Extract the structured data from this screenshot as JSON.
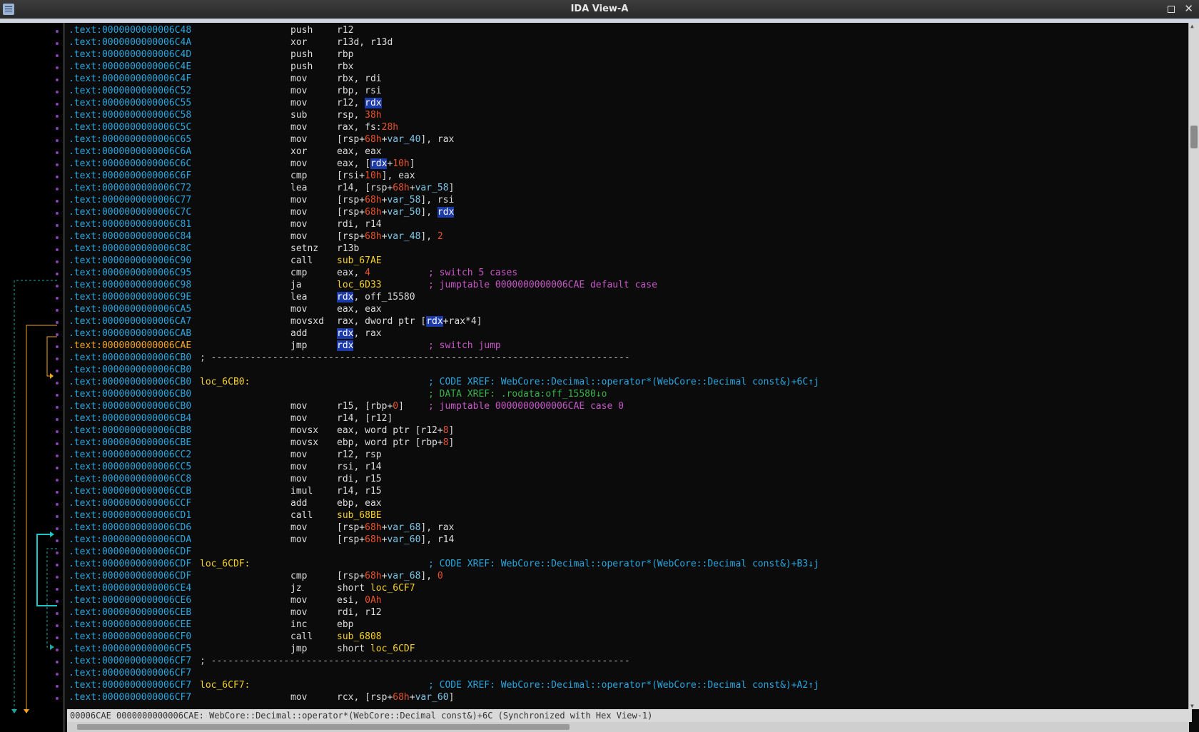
{
  "window": {
    "title": "IDA View-A"
  },
  "status": "00006CAE 0000000000006CAE: WebCore::Decimal::operator*(WebCore::Decimal const&)+6C (Synchronized with Hex View-1)",
  "rows": [
    {
      "a": ".text:0000000000006C48",
      "m": "push",
      "o": [
        [
          "r12",
          "reg"
        ]
      ]
    },
    {
      "a": ".text:0000000000006C4A",
      "m": "xor",
      "o": [
        [
          "r13d, r13d",
          "reg"
        ]
      ]
    },
    {
      "a": ".text:0000000000006C4D",
      "m": "push",
      "o": [
        [
          "rbp",
          "reg"
        ]
      ]
    },
    {
      "a": ".text:0000000000006C4E",
      "m": "push",
      "o": [
        [
          "rbx",
          "reg"
        ]
      ]
    },
    {
      "a": ".text:0000000000006C4F",
      "m": "mov",
      "o": [
        [
          "rbx, rdi",
          "reg"
        ]
      ]
    },
    {
      "a": ".text:0000000000006C52",
      "m": "mov",
      "o": [
        [
          "rbp, rsi",
          "reg"
        ]
      ]
    },
    {
      "a": ".text:0000000000006C55",
      "m": "mov",
      "o": [
        [
          "r12, ",
          "reg"
        ],
        [
          "rdx",
          "hl"
        ]
      ]
    },
    {
      "a": ".text:0000000000006C58",
      "m": "sub",
      "o": [
        [
          "rsp, ",
          "reg"
        ],
        [
          "38h",
          "num"
        ]
      ]
    },
    {
      "a": ".text:0000000000006C5C",
      "m": "mov",
      "o": [
        [
          "rax, fs:",
          "reg"
        ],
        [
          "28h",
          "num"
        ]
      ]
    },
    {
      "a": ".text:0000000000006C65",
      "m": "mov",
      "o": [
        [
          "[rsp+",
          "reg"
        ],
        [
          "68h",
          "num"
        ],
        [
          "+",
          "reg"
        ],
        [
          "var_40",
          "var"
        ],
        [
          "], rax",
          "reg"
        ]
      ]
    },
    {
      "a": ".text:0000000000006C6A",
      "m": "xor",
      "o": [
        [
          "eax, eax",
          "reg"
        ]
      ]
    },
    {
      "a": ".text:0000000000006C6C",
      "m": "mov",
      "o": [
        [
          "eax, [",
          "reg"
        ],
        [
          "rdx",
          "hl"
        ],
        [
          "+",
          "reg"
        ],
        [
          "10h",
          "num"
        ],
        [
          "]",
          "reg"
        ]
      ]
    },
    {
      "a": ".text:0000000000006C6F",
      "m": "cmp",
      "o": [
        [
          "[rsi+",
          "reg"
        ],
        [
          "10h",
          "num"
        ],
        [
          "], eax",
          "reg"
        ]
      ]
    },
    {
      "a": ".text:0000000000006C72",
      "m": "lea",
      "o": [
        [
          "r14, [rsp+",
          "reg"
        ],
        [
          "68h",
          "num"
        ],
        [
          "+",
          "reg"
        ],
        [
          "var_58",
          "var"
        ],
        [
          "]",
          "reg"
        ]
      ]
    },
    {
      "a": ".text:0000000000006C77",
      "m": "mov",
      "o": [
        [
          "[rsp+",
          "reg"
        ],
        [
          "68h",
          "num"
        ],
        [
          "+",
          "reg"
        ],
        [
          "var_58",
          "var"
        ],
        [
          "], rsi",
          "reg"
        ]
      ]
    },
    {
      "a": ".text:0000000000006C7C",
      "m": "mov",
      "o": [
        [
          "[rsp+",
          "reg"
        ],
        [
          "68h",
          "num"
        ],
        [
          "+",
          "reg"
        ],
        [
          "var_50",
          "var"
        ],
        [
          "], ",
          "reg"
        ],
        [
          "rdx",
          "hl"
        ]
      ]
    },
    {
      "a": ".text:0000000000006C81",
      "m": "mov",
      "o": [
        [
          "rdi, r14",
          "reg"
        ]
      ]
    },
    {
      "a": ".text:0000000000006C84",
      "m": "mov",
      "o": [
        [
          "[rsp+",
          "reg"
        ],
        [
          "68h",
          "num"
        ],
        [
          "+",
          "reg"
        ],
        [
          "var_48",
          "var"
        ],
        [
          "], ",
          "reg"
        ],
        [
          "2",
          "num"
        ]
      ]
    },
    {
      "a": ".text:0000000000006C8C",
      "m": "setnz",
      "o": [
        [
          "r13b",
          "reg"
        ]
      ]
    },
    {
      "a": ".text:0000000000006C90",
      "m": "call",
      "o": [
        [
          "sub_67AE",
          "sym"
        ]
      ]
    },
    {
      "a": ".text:0000000000006C95",
      "m": "cmp",
      "o": [
        [
          "eax, ",
          "reg"
        ],
        [
          "4",
          "num"
        ]
      ],
      "c": [
        [
          "; switch 5 cases",
          "mag"
        ]
      ]
    },
    {
      "a": ".text:0000000000006C98",
      "m": "ja",
      "o": [
        [
          "loc_6D33",
          "sym"
        ]
      ],
      "c": [
        [
          "; jumptable 0000000000006CAE default case",
          "mag"
        ]
      ]
    },
    {
      "a": ".text:0000000000006C9E",
      "m": "lea",
      "o": [
        [
          "rdx",
          "hl"
        ],
        [
          ", off_15580",
          "reg"
        ]
      ]
    },
    {
      "a": ".text:0000000000006CA5",
      "m": "mov",
      "o": [
        [
          "eax, eax",
          "reg"
        ]
      ]
    },
    {
      "a": ".text:0000000000006CA7",
      "m": "movsxd",
      "o": [
        [
          "rax, dword ptr [",
          "reg"
        ],
        [
          "rdx",
          "hl"
        ],
        [
          "+rax*4]",
          "reg"
        ]
      ]
    },
    {
      "a": ".text:0000000000006CAB",
      "m": "add",
      "o": [
        [
          "rdx",
          "hl"
        ],
        [
          ", rax",
          "reg"
        ]
      ]
    },
    {
      "a": ".text:0000000000006CAE",
      "cur": true,
      "m": "jmp",
      "o": [
        [
          "rdx",
          "hl"
        ]
      ],
      "c": [
        [
          "; switch jump",
          "mag"
        ]
      ]
    },
    {
      "a": ".text:0000000000006CB0",
      "sep": "; ---------------------------------------------------------------------------"
    },
    {
      "a": ".text:0000000000006CB0"
    },
    {
      "a": ".text:0000000000006CB0",
      "l": "loc_6CB0:",
      "c": [
        [
          "; CODE XREF: WebCore::Decimal::operator*(WebCore::Decimal const&)+6C↑j",
          "cyan"
        ]
      ]
    },
    {
      "a": ".text:0000000000006CB0",
      "c": [
        [
          "; DATA XREF: .rodata:off_15580↓o",
          "green"
        ]
      ]
    },
    {
      "a": ".text:0000000000006CB0",
      "m": "mov",
      "o": [
        [
          "r15, [rbp+",
          "reg"
        ],
        [
          "0",
          "num"
        ],
        [
          "]",
          "reg"
        ]
      ],
      "c": [
        [
          "; jumptable 0000000000006CAE case 0",
          "mag"
        ]
      ]
    },
    {
      "a": ".text:0000000000006CB4",
      "m": "mov",
      "o": [
        [
          "r14, [r12]",
          "reg"
        ]
      ]
    },
    {
      "a": ".text:0000000000006CB8",
      "m": "movsx",
      "o": [
        [
          "eax, word ptr [r12+",
          "reg"
        ],
        [
          "8",
          "num"
        ],
        [
          "]",
          "reg"
        ]
      ]
    },
    {
      "a": ".text:0000000000006CBE",
      "m": "movsx",
      "o": [
        [
          "ebp, word ptr [rbp+",
          "reg"
        ],
        [
          "8",
          "num"
        ],
        [
          "]",
          "reg"
        ]
      ]
    },
    {
      "a": ".text:0000000000006CC2",
      "m": "mov",
      "o": [
        [
          "r12, rsp",
          "reg"
        ]
      ]
    },
    {
      "a": ".text:0000000000006CC5",
      "m": "mov",
      "o": [
        [
          "rsi, r14",
          "reg"
        ]
      ]
    },
    {
      "a": ".text:0000000000006CC8",
      "m": "mov",
      "o": [
        [
          "rdi, r15",
          "reg"
        ]
      ]
    },
    {
      "a": ".text:0000000000006CCB",
      "m": "imul",
      "o": [
        [
          "r14, r15",
          "reg"
        ]
      ]
    },
    {
      "a": ".text:0000000000006CCF",
      "m": "add",
      "o": [
        [
          "ebp, eax",
          "reg"
        ]
      ]
    },
    {
      "a": ".text:0000000000006CD1",
      "m": "call",
      "o": [
        [
          "sub_68BE",
          "sym"
        ]
      ]
    },
    {
      "a": ".text:0000000000006CD6",
      "m": "mov",
      "o": [
        [
          "[rsp+",
          "reg"
        ],
        [
          "68h",
          "num"
        ],
        [
          "+",
          "reg"
        ],
        [
          "var_68",
          "var"
        ],
        [
          "], rax",
          "reg"
        ]
      ]
    },
    {
      "a": ".text:0000000000006CDA",
      "m": "mov",
      "o": [
        [
          "[rsp+",
          "reg"
        ],
        [
          "68h",
          "num"
        ],
        [
          "+",
          "reg"
        ],
        [
          "var_60",
          "var"
        ],
        [
          "], r14",
          "reg"
        ]
      ]
    },
    {
      "a": ".text:0000000000006CDF"
    },
    {
      "a": ".text:0000000000006CDF",
      "l": "loc_6CDF:",
      "c": [
        [
          "; CODE XREF: WebCore::Decimal::operator*(WebCore::Decimal const&)+B3↓j",
          "cyan"
        ]
      ]
    },
    {
      "a": ".text:0000000000006CDF",
      "m": "cmp",
      "o": [
        [
          "[rsp+",
          "reg"
        ],
        [
          "68h",
          "num"
        ],
        [
          "+",
          "reg"
        ],
        [
          "var_68",
          "var"
        ],
        [
          "], ",
          "reg"
        ],
        [
          "0",
          "num"
        ]
      ]
    },
    {
      "a": ".text:0000000000006CE4",
      "m": "jz",
      "o": [
        [
          "short ",
          "reg"
        ],
        [
          "loc_6CF7",
          "sym"
        ]
      ]
    },
    {
      "a": ".text:0000000000006CE6",
      "m": "mov",
      "o": [
        [
          "esi, ",
          "reg"
        ],
        [
          "0Ah",
          "num"
        ]
      ]
    },
    {
      "a": ".text:0000000000006CEB",
      "m": "mov",
      "o": [
        [
          "rdi, r12",
          "reg"
        ]
      ]
    },
    {
      "a": ".text:0000000000006CEE",
      "m": "inc",
      "o": [
        [
          "ebp",
          "reg"
        ]
      ]
    },
    {
      "a": ".text:0000000000006CF0",
      "m": "call",
      "o": [
        [
          "sub_6808",
          "sym"
        ]
      ]
    },
    {
      "a": ".text:0000000000006CF5",
      "m": "jmp",
      "o": [
        [
          "short ",
          "reg"
        ],
        [
          "loc_6CDF",
          "sym"
        ]
      ]
    },
    {
      "a": ".text:0000000000006CF7",
      "sep": "; ---------------------------------------------------------------------------"
    },
    {
      "a": ".text:0000000000006CF7"
    },
    {
      "a": ".text:0000000000006CF7",
      "l": "loc_6CF7:",
      "c": [
        [
          "; CODE XREF: WebCore::Decimal::operator*(WebCore::Decimal const&)+A2↑j",
          "cyan"
        ]
      ]
    },
    {
      "a": ".text:0000000000006CF7",
      "m": "mov",
      "o": [
        [
          "rcx, [rsp+",
          "reg"
        ],
        [
          "68h",
          "num"
        ],
        [
          "+",
          "reg"
        ],
        [
          "var_60",
          "var"
        ],
        [
          "]",
          "reg"
        ]
      ]
    }
  ]
}
